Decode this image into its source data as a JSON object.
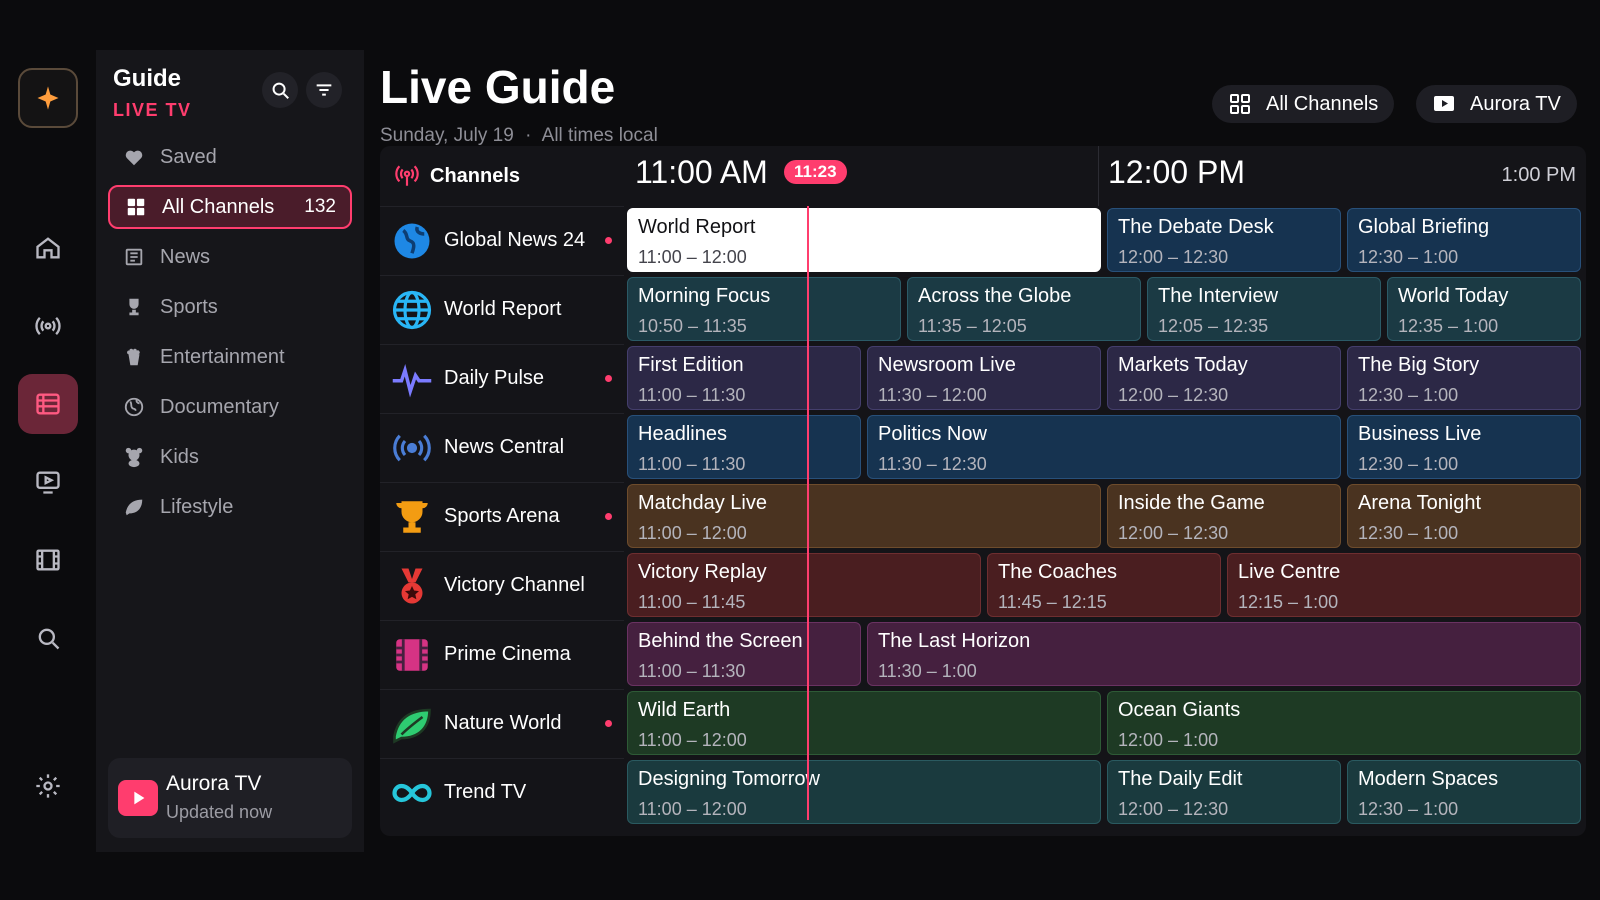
{
  "rail": {
    "items": [
      "sparkle-icon",
      "home-icon",
      "antenna-icon",
      "guide-icon",
      "tv-icon",
      "film-icon",
      "search-icon",
      "gear-icon"
    ],
    "active": "guide-icon",
    "accent": "#ff3d6e"
  },
  "side": {
    "title": "Guide",
    "subtitle": "LIVE TV",
    "nav": [
      {
        "label": "Saved",
        "icon": "heart-icon"
      },
      {
        "label": "All Channels",
        "icon": "grid-icon",
        "count": "132",
        "active": true
      },
      {
        "label": "News",
        "icon": "newspaper-icon"
      },
      {
        "label": "Sports",
        "icon": "trophy-icon"
      },
      {
        "label": "Entertainment",
        "icon": "popcorn-icon"
      },
      {
        "label": "Documentary",
        "icon": "globe-icon"
      },
      {
        "label": "Kids",
        "icon": "teddy-icon"
      },
      {
        "label": "Lifestyle",
        "icon": "leaf-icon"
      }
    ],
    "provider": {
      "name": "Aurora TV",
      "status": "Updated now"
    }
  },
  "header": {
    "title": "Live Guide",
    "date": "Sunday, July 19",
    "sep": "·",
    "tz": "All times local",
    "filter_label": "All Channels",
    "provider_label": "Aurora TV"
  },
  "guide": {
    "channels_label": "Channels",
    "times": [
      "11:00 AM",
      "12:00 PM",
      "1:00 PM"
    ],
    "now": "11:23",
    "rows": [
      {
        "channel": "Global News 24",
        "logo": "globe-icon",
        "dot": true,
        "programs": [
          {
            "title": "World Report",
            "time": "11:00 – 12:00",
            "start": 0,
            "end": 60,
            "color": "news",
            "selected": true
          },
          {
            "title": "The Debate Desk",
            "time": "12:00 – 12:30",
            "start": 60,
            "end": 90,
            "color": "news"
          },
          {
            "title": "Global Briefing",
            "time": "12:30 – 1:00",
            "start": 90,
            "end": 120,
            "color": "news"
          }
        ]
      },
      {
        "channel": "World Report",
        "logo": "world-icon",
        "dot": false,
        "programs": [
          {
            "title": "Morning Focus",
            "time": "10:50 – 11:35",
            "start": 0,
            "end": 35,
            "color": "teal"
          },
          {
            "title": "Across the Globe",
            "time": "11:35 – 12:05",
            "start": 35,
            "end": 65,
            "color": "teal"
          },
          {
            "title": "The Interview",
            "time": "12:05 – 12:35",
            "start": 65,
            "end": 95,
            "color": "teal"
          },
          {
            "title": "World Today",
            "time": "12:35 – 1:00",
            "start": 95,
            "end": 120,
            "color": "teal"
          }
        ]
      },
      {
        "channel": "Daily Pulse",
        "logo": "pulse-icon",
        "dot": true,
        "programs": [
          {
            "title": "First Edition",
            "time": "11:00 – 11:30",
            "start": 0,
            "end": 30,
            "color": "purple"
          },
          {
            "title": "Newsroom Live",
            "time": "11:30 – 12:00",
            "start": 30,
            "end": 60,
            "color": "purple"
          },
          {
            "title": "Markets Today",
            "time": "12:00 – 12:30",
            "start": 60,
            "end": 90,
            "color": "purple"
          },
          {
            "title": "The Big Story",
            "time": "12:30 – 1:00",
            "start": 90,
            "end": 120,
            "color": "purple"
          }
        ]
      },
      {
        "channel": "News Central",
        "logo": "broadcast-icon",
        "dot": false,
        "programs": [
          {
            "title": "Headlines",
            "time": "11:00 – 11:30",
            "start": 0,
            "end": 30,
            "color": "news"
          },
          {
            "title": "Politics Now",
            "time": "11:30 – 12:30",
            "start": 30,
            "end": 90,
            "color": "news"
          },
          {
            "title": "Business Live",
            "time": "12:30 – 1:00",
            "start": 90,
            "end": 120,
            "color": "news"
          }
        ]
      },
      {
        "channel": "Sports Arena",
        "logo": "trophy-icon",
        "dot": true,
        "programs": [
          {
            "title": "Matchday Live",
            "time": "11:00 – 12:00",
            "start": 0,
            "end": 60,
            "color": "brown"
          },
          {
            "title": "Inside the Game",
            "time": "12:00 – 12:30",
            "start": 60,
            "end": 90,
            "color": "brown"
          },
          {
            "title": "Arena Tonight",
            "time": "12:30 – 1:00",
            "start": 90,
            "end": 120,
            "color": "brown"
          }
        ]
      },
      {
        "channel": "Victory Channel",
        "logo": "medal-icon",
        "dot": false,
        "programs": [
          {
            "title": "Victory Replay",
            "time": "11:00 – 11:45",
            "start": 0,
            "end": 45,
            "color": "red"
          },
          {
            "title": "The Coaches",
            "time": "11:45 – 12:15",
            "start": 45,
            "end": 75,
            "color": "red"
          },
          {
            "title": "Live Centre",
            "time": "12:15 – 1:00",
            "start": 75,
            "end": 120,
            "color": "red"
          }
        ]
      },
      {
        "channel": "Prime Cinema",
        "logo": "film-icon",
        "dot": false,
        "programs": [
          {
            "title": "Behind the Screen",
            "time": "11:00 – 11:30",
            "start": 0,
            "end": 30,
            "color": "magenta"
          },
          {
            "title": "The Last Horizon",
            "time": "11:30 – 1:00",
            "start": 30,
            "end": 120,
            "color": "magenta"
          }
        ]
      },
      {
        "channel": "Nature World",
        "logo": "leaf-icon",
        "dot": true,
        "programs": [
          {
            "title": "Wild Earth",
            "time": "11:00 – 12:00",
            "start": 0,
            "end": 60,
            "color": "green"
          },
          {
            "title": "Ocean Giants",
            "time": "12:00 – 1:00",
            "start": 60,
            "end": 120,
            "color": "green"
          }
        ]
      },
      {
        "channel": "Trend TV",
        "logo": "infinity-icon",
        "dot": false,
        "programs": [
          {
            "title": "Designing Tomorrow",
            "time": "11:00 – 12:00",
            "start": 0,
            "end": 60,
            "color": "cyan"
          },
          {
            "title": "The Daily Edit",
            "time": "12:00 – 12:30",
            "start": 60,
            "end": 90,
            "color": "cyan"
          },
          {
            "title": "Modern Spaces",
            "time": "12:30 – 1:00",
            "start": 90,
            "end": 120,
            "color": "cyan"
          }
        ]
      }
    ]
  }
}
